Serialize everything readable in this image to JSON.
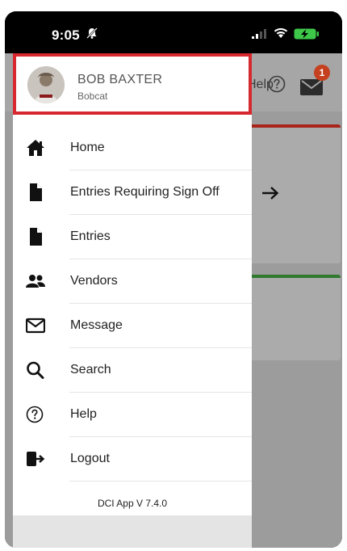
{
  "status_bar": {
    "time": "9:05",
    "icons": [
      "bell-slash-icon",
      "signal-icon",
      "wifi-icon",
      "battery-charging-icon"
    ]
  },
  "background_app": {
    "help_label": "Help",
    "notification_count": "1",
    "icons": [
      "help-circle-icon",
      "mail-icon",
      "arrow-right-icon"
    ],
    "colors": {
      "card_1_accent": "#a8241b",
      "card_2_accent": "#2f7a2f",
      "badge": "#c5401e"
    }
  },
  "profile": {
    "name": "BOB BAXTER",
    "subtitle": "Bobcat",
    "highlight_color": "#d6292f"
  },
  "menu": {
    "items": [
      {
        "label": "Home",
        "icon": "home-icon"
      },
      {
        "label": "Entries Requiring Sign Off",
        "icon": "document-icon"
      },
      {
        "label": "Entries",
        "icon": "document-icon"
      },
      {
        "label": "Vendors",
        "icon": "users-icon"
      },
      {
        "label": "Message",
        "icon": "envelope-icon"
      },
      {
        "label": "Search",
        "icon": "search-icon"
      },
      {
        "label": "Help",
        "icon": "help-circle-icon"
      },
      {
        "label": "Logout",
        "icon": "logout-icon"
      }
    ]
  },
  "footer": {
    "version": "DCI App V 7.4.0"
  }
}
